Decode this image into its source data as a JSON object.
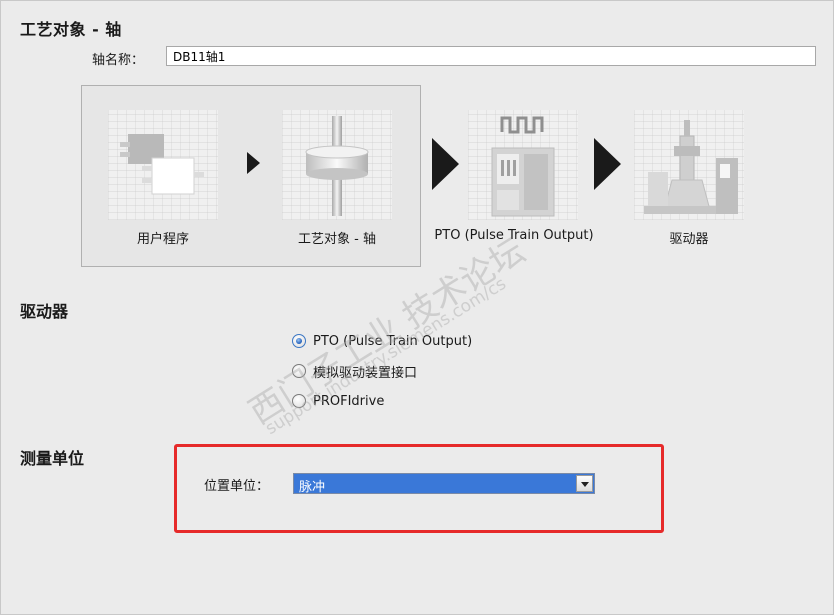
{
  "header": {
    "title": "工艺对象 - 轴"
  },
  "axis_name": {
    "label": "轴名称：",
    "value": "DB11轴1"
  },
  "flow": {
    "steps": [
      {
        "label": "用户程序",
        "icon": "user-program-icon"
      },
      {
        "label": "工艺对象 - 轴",
        "icon": "technology-object-axis-icon"
      },
      {
        "label": "PTO (Pulse Train Output)",
        "icon": "pto-pulse-icon"
      },
      {
        "label": "驱动器",
        "icon": "drive-icon"
      }
    ]
  },
  "drive_section": {
    "title": "驱动器",
    "options": [
      {
        "label": "PTO (Pulse Train Output)",
        "selected": true
      },
      {
        "label": "模拟驱动装置接口",
        "selected": false
      },
      {
        "label": "PROFIdrive",
        "selected": false
      }
    ]
  },
  "measure_section": {
    "title": "测量单位",
    "position_unit_label": "位置单位：",
    "position_unit_value": "脉冲"
  },
  "watermark": {
    "line1": "西门子工业 技术论坛",
    "line2": "support.industry.siemens.com/cs"
  },
  "colors": {
    "highlight_border": "#e62a2a",
    "select_bg": "#3a78d8",
    "radio_selected": "#2f6bc2"
  }
}
